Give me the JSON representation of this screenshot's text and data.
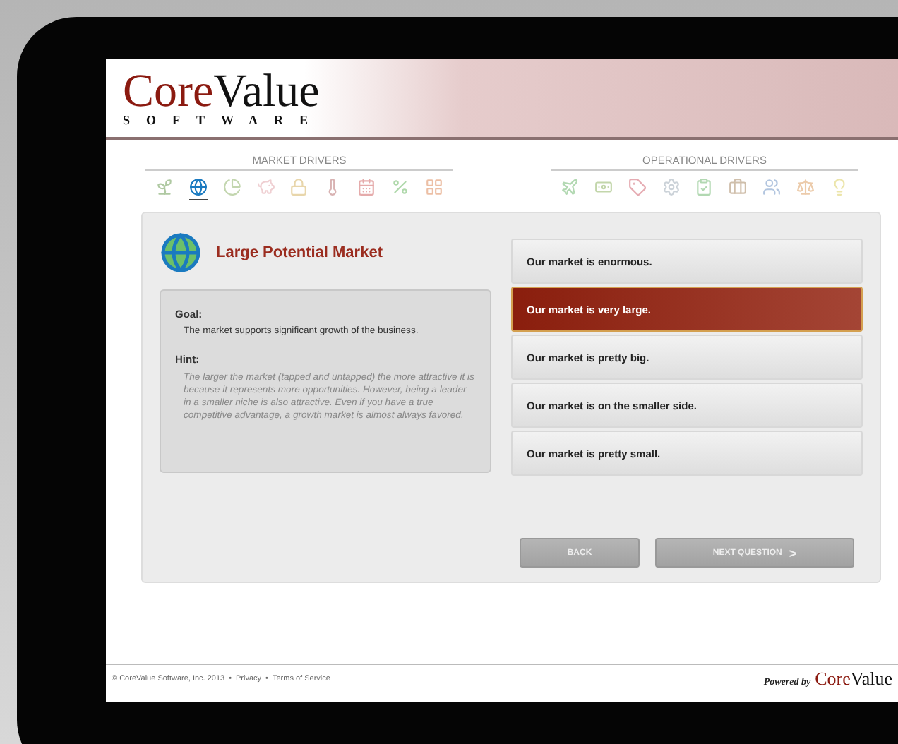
{
  "logo": {
    "first": "Core",
    "second": "Value",
    "subtitle": "SOFTWARE"
  },
  "driver_groups": [
    {
      "title": "MARKET DRIVERS",
      "items": [
        {
          "kind": "plant",
          "selected": false
        },
        {
          "kind": "globe",
          "selected": true
        },
        {
          "kind": "pie",
          "selected": false
        },
        {
          "kind": "piggy",
          "selected": false
        },
        {
          "kind": "lock",
          "selected": false
        },
        {
          "kind": "thermometer",
          "selected": false
        },
        {
          "kind": "calendar",
          "selected": false
        },
        {
          "kind": "percent",
          "selected": false
        },
        {
          "kind": "grid",
          "selected": false
        }
      ]
    },
    {
      "title": "OPERATIONAL DRIVERS",
      "items": [
        {
          "kind": "plane",
          "selected": false
        },
        {
          "kind": "money",
          "selected": false
        },
        {
          "kind": "tag",
          "selected": false
        },
        {
          "kind": "gear",
          "selected": false
        },
        {
          "kind": "clipboard",
          "selected": false
        },
        {
          "kind": "briefcase",
          "selected": false
        },
        {
          "kind": "people",
          "selected": false
        },
        {
          "kind": "scale",
          "selected": false
        },
        {
          "kind": "bulb",
          "selected": false
        }
      ]
    }
  ],
  "question": {
    "title": "Large Potential Market",
    "goal_label": "Goal:",
    "goal": "The market supports significant growth of the business.",
    "hint_label": "Hint:",
    "hint": "The larger the market (tapped and untapped) the more attractive it is because it represents more opportunities. However, being a leader in a smaller niche is also attractive. Even if you have a true competitive advantage, a growth market is almost always favored."
  },
  "answers": [
    {
      "label": "Our market is enormous.",
      "selected": false
    },
    {
      "label": "Our market is very large.",
      "selected": true
    },
    {
      "label": "Our market is pretty big.",
      "selected": false
    },
    {
      "label": "Our market is on the smaller side.",
      "selected": false
    },
    {
      "label": "Our market is pretty small.",
      "selected": false
    }
  ],
  "buttons": {
    "back": "BACK",
    "next": "NEXT QUESTION",
    "next_arrow": ">"
  },
  "footer": {
    "copyright": "© CoreValue Software, Inc. 2013",
    "separator": "•",
    "links": [
      "Privacy",
      "Terms of Service"
    ],
    "powered_by": "Powered by",
    "brand_first": "Core",
    "brand_second": "Value"
  }
}
